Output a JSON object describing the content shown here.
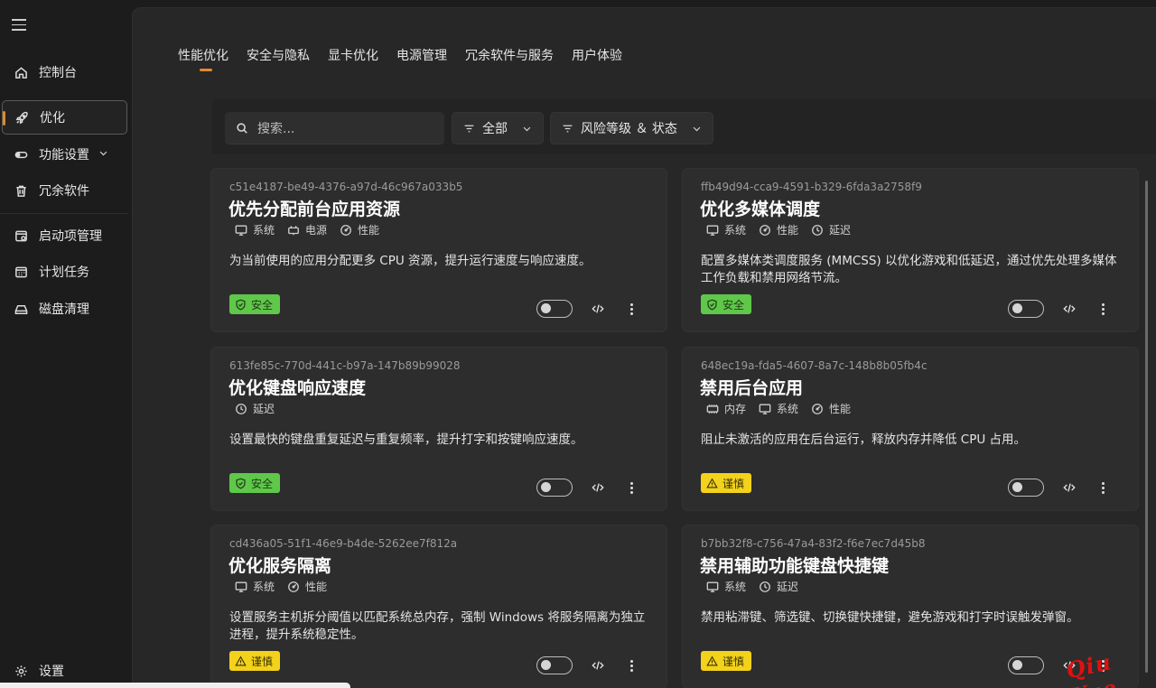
{
  "sidebar": {
    "menu_icon": "hamburger-icon",
    "items": [
      {
        "label": "控制台",
        "icon": "home-icon"
      },
      {
        "label": "优化",
        "icon": "rocket-icon"
      },
      {
        "label": "功能设置",
        "icon": "toggle-icon"
      },
      {
        "label": "冗余软件",
        "icon": "trash-icon"
      },
      {
        "label": "启动项管理",
        "icon": "startup-icon"
      },
      {
        "label": "计划任务",
        "icon": "calendar-icon"
      },
      {
        "label": "磁盘清理",
        "icon": "disk-icon"
      }
    ],
    "settings_label": "设置"
  },
  "tabs": [
    "性能优化",
    "安全与隐私",
    "显卡优化",
    "电源管理",
    "冗余软件与服务",
    "用户体验"
  ],
  "toolbar": {
    "search_placeholder": "搜索...",
    "filter_all": "全部",
    "filter_risk": "风险等级 ＆ 状态"
  },
  "cards": [
    {
      "uuid": "c51e4187-be49-4376-a97d-46c967a033b5",
      "title": "优先分配前台应用资源",
      "tags": [
        "系统",
        "电源",
        "性能"
      ],
      "desc": "为当前使用的应用分配更多 CPU 资源，提升运行速度与响应速度。",
      "badge": "安全"
    },
    {
      "uuid": "ffb49d94-cca9-4591-b329-6fda3a2758f9",
      "title": "优化多媒体调度",
      "tags": [
        "系统",
        "性能",
        "延迟"
      ],
      "desc": "配置多媒体类调度服务 (MMCSS) 以优化游戏和低延迟，通过优先处理多媒体工作负载和禁用网络节流。",
      "badge": "安全"
    },
    {
      "uuid": "613fe85c-770d-441c-b97a-147b89b99028",
      "title": "优化键盘响应速度",
      "tags": [
        "延迟"
      ],
      "desc": "设置最快的键盘重复延迟与重复频率，提升打字和按键响应速度。",
      "badge": "安全"
    },
    {
      "uuid": "648ec19a-fda5-4607-8a7c-148b8b05fb4c",
      "title": "禁用后台应用",
      "tags": [
        "内存",
        "系统",
        "性能"
      ],
      "desc": "阻止未激活的应用在后台运行，释放内存并降低 CPU 占用。",
      "badge": "谨慎"
    },
    {
      "uuid": "cd436a05-51f1-46e9-b4de-5262ee7f812a",
      "title": "优化服务隔离",
      "tags": [
        "系统",
        "性能"
      ],
      "desc": "设置服务主机拆分阈值以匹配系统总内存，强制 Windows 将服务隔离为独立进程，提升系统稳定性。",
      "badge": "谨慎"
    },
    {
      "uuid": "b7bb32f8-c756-47a4-83f2-f6e7ec7d45b8",
      "title": "禁用辅助功能键盘快捷键",
      "tags": [
        "系统",
        "延迟"
      ],
      "desc": "禁用粘滞键、筛选键、切换键快捷键，避免游戏和打字时误触发弹窗。",
      "badge": "谨慎"
    }
  ],
  "colors": {
    "accent": "#e08a2c",
    "safe": "#5fc84a",
    "caution": "#f3d21b"
  },
  "watermark": "Qiu Yue"
}
